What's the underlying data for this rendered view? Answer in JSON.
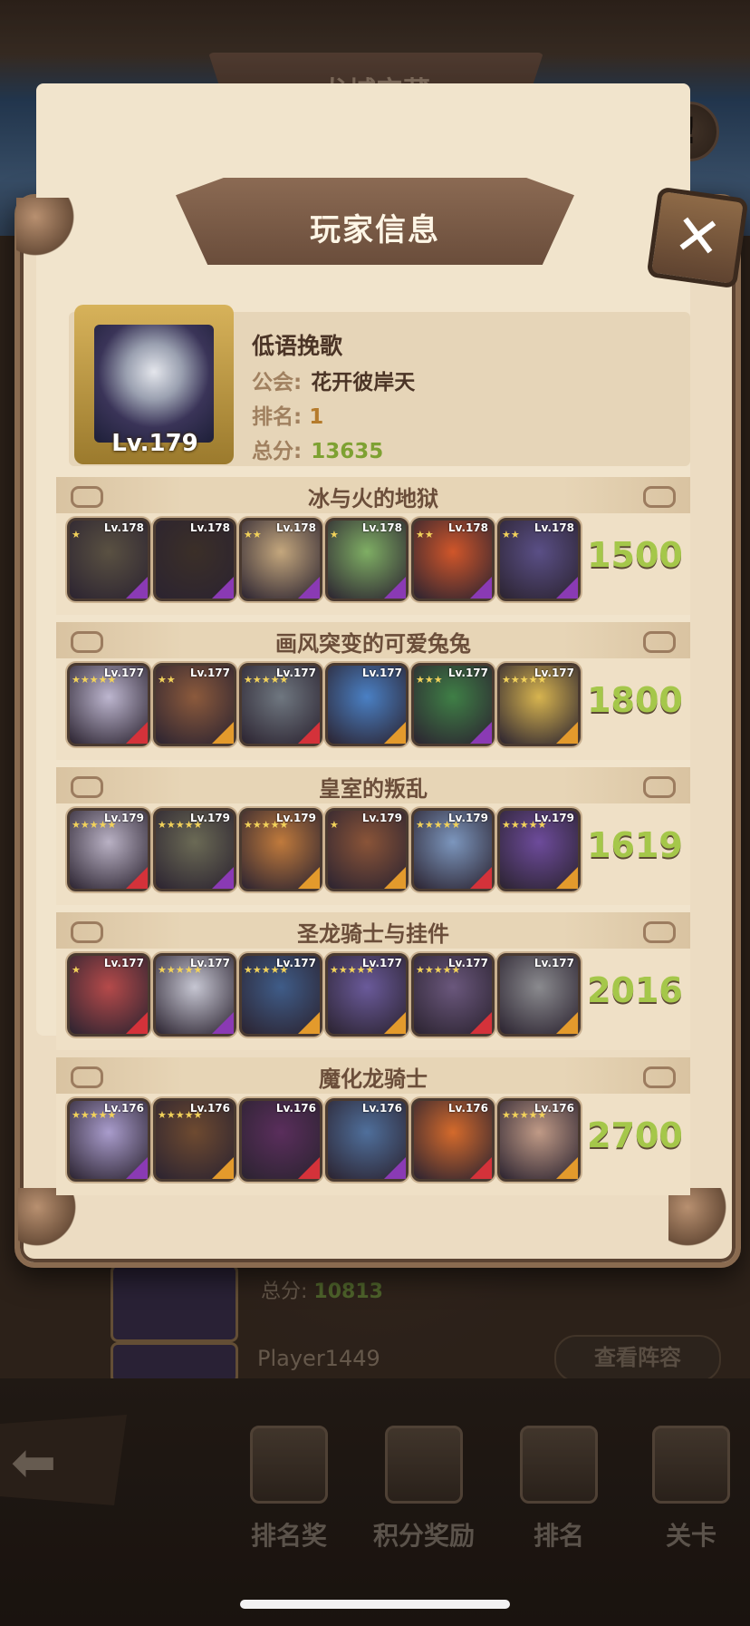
{
  "screen_title": "龙城宝藏",
  "alert_icon": "!",
  "dialog": {
    "title": "玩家信息",
    "close_icon": "✕"
  },
  "player": {
    "level": "Lv.179",
    "name": "低语挽歌",
    "guild_label": "公会:",
    "guild": "花开彼岸天",
    "rank_label": "排名:",
    "rank": "1",
    "score_label": "总分:",
    "score": "13635"
  },
  "teams": [
    {
      "title": "冰与火的地狱",
      "score": "1500",
      "heroes": [
        {
          "level": "Lv.178",
          "stars": 1,
          "color": "#5a5142",
          "rarity": "#8a3ab4"
        },
        {
          "level": "Lv.178",
          "stars": 0,
          "color": "#3b2f28",
          "rarity": "#8a3ab4"
        },
        {
          "level": "Lv.178",
          "stars": 2,
          "color": "#c4a77d",
          "rarity": "#8a3ab4"
        },
        {
          "level": "Lv.178",
          "stars": 1,
          "color": "#7fae64",
          "rarity": "#8a3ab4"
        },
        {
          "level": "Lv.178",
          "stars": 2,
          "color": "#d0562a",
          "rarity": "#8a3ab4"
        },
        {
          "level": "Lv.178",
          "stars": 2,
          "color": "#5a4f86",
          "rarity": "#8a3ab4"
        }
      ]
    },
    {
      "title": "画风突变的可爱兔兔",
      "score": "1800",
      "heroes": [
        {
          "level": "Lv.177",
          "stars": 5,
          "color": "#bdb6cf",
          "rarity": "#d4323a"
        },
        {
          "level": "Lv.177",
          "stars": 2,
          "color": "#8c5a3c",
          "rarity": "#e39a2c"
        },
        {
          "level": "Lv.177",
          "stars": 5,
          "color": "#6f7780",
          "rarity": "#d4323a"
        },
        {
          "level": "Lv.177",
          "stars": 0,
          "color": "#4a80c4",
          "rarity": "#e39a2c"
        },
        {
          "level": "Lv.177",
          "stars": 3,
          "color": "#3f7f46",
          "rarity": "#8a3ab4"
        },
        {
          "level": "Lv.177",
          "stars": 5,
          "color": "#d7b44f",
          "rarity": "#e39a2c"
        }
      ]
    },
    {
      "title": "皇室的叛乱",
      "score": "1619",
      "heroes": [
        {
          "level": "Lv.179",
          "stars": 5,
          "color": "#b9b1c4",
          "rarity": "#d4323a"
        },
        {
          "level": "Lv.179",
          "stars": 5,
          "color": "#6b6a55",
          "rarity": "#8a3ab4"
        },
        {
          "level": "Lv.179",
          "stars": 5,
          "color": "#c07a3c",
          "rarity": "#e39a2c"
        },
        {
          "level": "Lv.179",
          "stars": 1,
          "color": "#8a5438",
          "rarity": "#e39a2c"
        },
        {
          "level": "Lv.179",
          "stars": 5,
          "color": "#7c96bd",
          "rarity": "#d4323a"
        },
        {
          "level": "Lv.179",
          "stars": 5,
          "color": "#6d4b9b",
          "rarity": "#e39a2c"
        }
      ]
    },
    {
      "title": "圣龙骑士与挂件",
      "score": "2016",
      "heroes": [
        {
          "level": "Lv.177",
          "stars": 1,
          "color": "#b54a4a",
          "rarity": "#d4323a"
        },
        {
          "level": "Lv.177",
          "stars": 5,
          "color": "#c6c6d2",
          "rarity": "#8a3ab4"
        },
        {
          "level": "Lv.177",
          "stars": 5,
          "color": "#3f5c88",
          "rarity": "#e39a2c"
        },
        {
          "level": "Lv.177",
          "stars": 5,
          "color": "#6a5a9a",
          "rarity": "#e39a2c"
        },
        {
          "level": "Lv.177",
          "stars": 5,
          "color": "#6a577c",
          "rarity": "#d4323a"
        },
        {
          "level": "Lv.177",
          "stars": 0,
          "color": "#8a8a8e",
          "rarity": "#e39a2c"
        }
      ]
    },
    {
      "title": "魔化龙骑士",
      "score": "2700",
      "heroes": [
        {
          "level": "Lv.176",
          "stars": 5,
          "color": "#a99ccc",
          "rarity": "#8a3ab4"
        },
        {
          "level": "Lv.176",
          "stars": 5,
          "color": "#6e4a30",
          "rarity": "#e39a2c"
        },
        {
          "level": "Lv.176",
          "stars": 0,
          "color": "#5a2e5c",
          "rarity": "#d4323a"
        },
        {
          "level": "Lv.176",
          "stars": 0,
          "color": "#4f6f9b",
          "rarity": "#8a3ab4"
        },
        {
          "level": "Lv.176",
          "stars": 0,
          "color": "#d46a2c",
          "rarity": "#d4323a"
        },
        {
          "level": "Lv.176",
          "stars": 5,
          "color": "#c09a86",
          "rarity": "#e39a2c"
        }
      ]
    }
  ],
  "background_list": {
    "row1_score_label": "总分:",
    "row1_score": "10813",
    "row2_name": "Player1449",
    "view_lineup_label": "查看阵容"
  },
  "bottom_nav": [
    {
      "label": "排名奖",
      "icon": "rank-reward-icon"
    },
    {
      "label": "积分奖励",
      "icon": "points-reward-icon"
    },
    {
      "label": "排名",
      "icon": "ranking-icon"
    },
    {
      "label": "关卡",
      "icon": "stage-icon"
    }
  ],
  "back_icon": "back-arrow-icon",
  "colors": {
    "score_green": "#a5c74a",
    "panel_bg": "#ecdcc2",
    "title_text": "#fff6e6"
  }
}
